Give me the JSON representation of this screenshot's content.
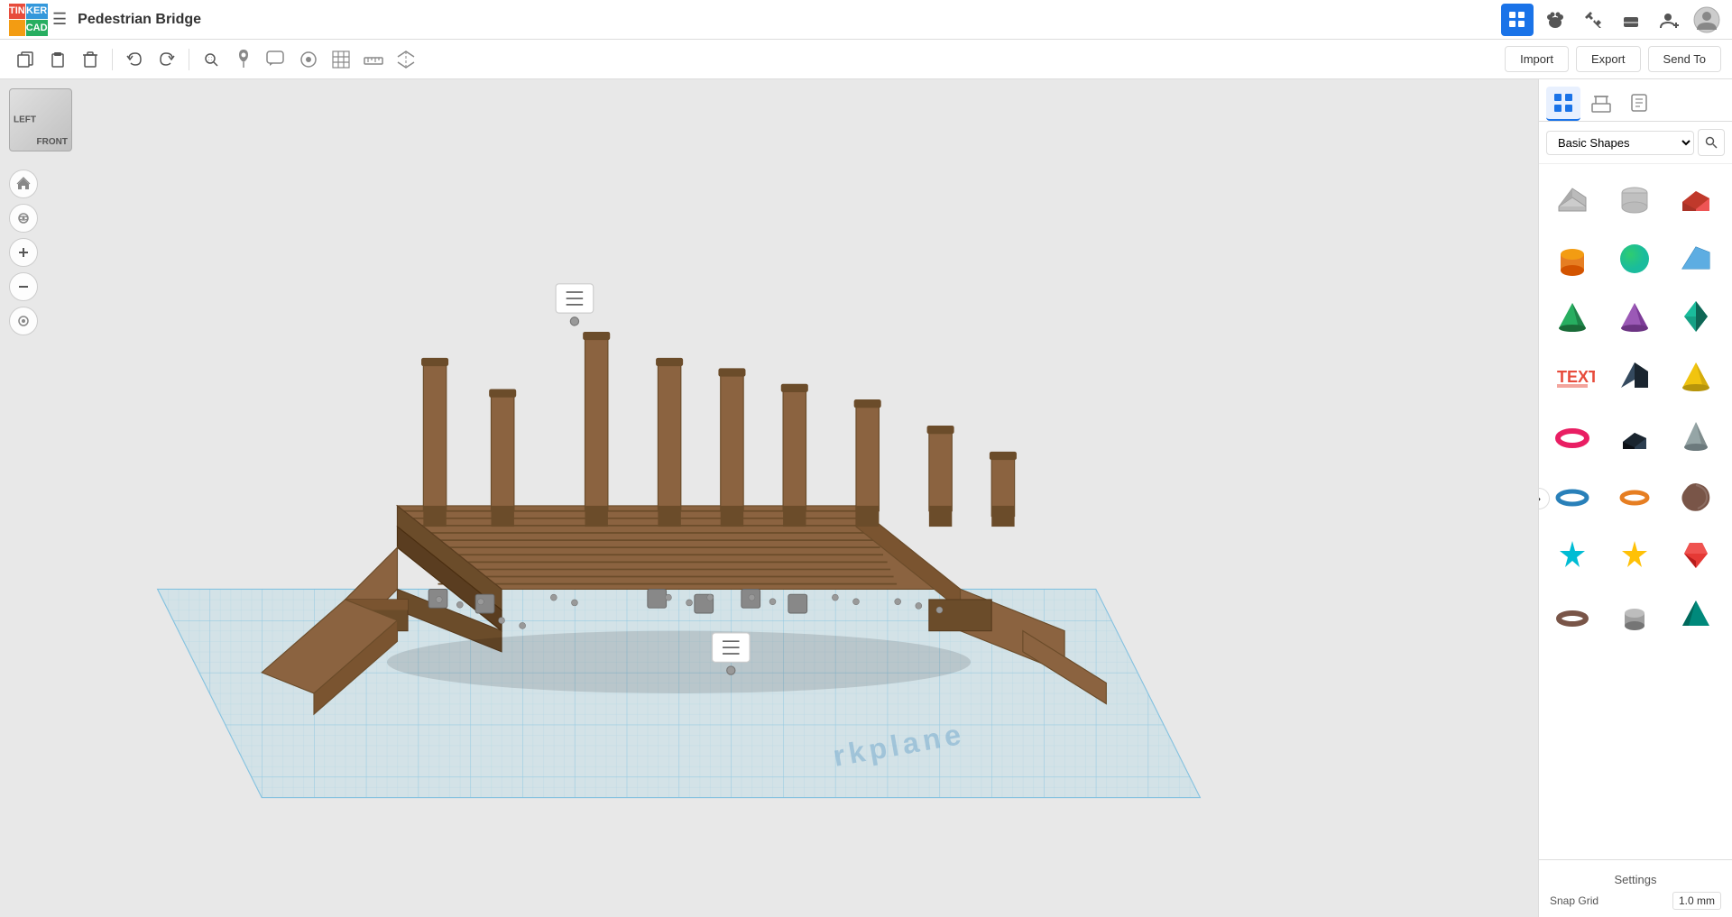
{
  "app": {
    "logo": {
      "cells": [
        "TIN",
        "KER",
        "CAD",
        ""
      ]
    },
    "project_title": "Pedestrian Bridge"
  },
  "toolbar": {
    "copy_label": "⧉",
    "paste_label": "📋",
    "delete_label": "🗑",
    "undo_label": "↩",
    "redo_label": "↪",
    "icons": {
      "search": "🔍",
      "pin": "📍",
      "bubble": "💬",
      "circle": "⭕",
      "grid": "⊞",
      "ruler": "📐",
      "flip": "⇄",
      "apps": "⊞",
      "paw": "🐾",
      "tools": "🔧",
      "briefcase": "💼",
      "profile": "👤"
    }
  },
  "view_toolbar": {
    "import_label": "Import",
    "export_label": "Export",
    "send_to_label": "Send To",
    "view_icons": [
      "🔍",
      "📍",
      "💬",
      "⭕",
      "⊞",
      "📐",
      "⇄"
    ]
  },
  "viewport": {
    "cube_labels": {
      "left": "LEFT",
      "front": "FRONT"
    },
    "workplane_text": "rkplane"
  },
  "right_panel": {
    "tabs": [
      {
        "id": "grid",
        "icon": "⊞",
        "active": true
      },
      {
        "id": "shape",
        "icon": "📐",
        "active": false
      },
      {
        "id": "notes",
        "icon": "📝",
        "active": false
      }
    ],
    "category_label": "Basic Shapes",
    "search_icon": "🔍",
    "shapes": [
      {
        "name": "Box hole",
        "color": "#aaa",
        "shape": "box-hole"
      },
      {
        "name": "Cylinder hole",
        "color": "#bbb",
        "shape": "cylinder-hole"
      },
      {
        "name": "Box solid",
        "color": "#e74c3c",
        "shape": "box-solid"
      },
      {
        "name": "Cylinder",
        "color": "#e67e22",
        "shape": "cylinder"
      },
      {
        "name": "Sphere",
        "color": "#1abc9c",
        "shape": "sphere"
      },
      {
        "name": "Shape3",
        "color": "#3498db",
        "shape": "wedge"
      },
      {
        "name": "Pyramid green",
        "color": "#27ae60",
        "shape": "pyramid-green"
      },
      {
        "name": "Pyramid purple",
        "color": "#9b59b6",
        "shape": "pyramid-purple"
      },
      {
        "name": "Diamond teal",
        "color": "#16a085",
        "shape": "diamond"
      },
      {
        "name": "Text",
        "color": "#e74c3c",
        "shape": "text"
      },
      {
        "name": "Prism blue",
        "color": "#2c3e50",
        "shape": "prism"
      },
      {
        "name": "Pyramid yellow",
        "color": "#f1c40f",
        "shape": "pyramid-yellow"
      },
      {
        "name": "Torus pink",
        "color": "#e91e63",
        "shape": "torus-pink"
      },
      {
        "name": "Box dark",
        "color": "#2c3e50",
        "shape": "box-dark"
      },
      {
        "name": "Cone gray",
        "color": "#95a5a6",
        "shape": "cone"
      },
      {
        "name": "Torus blue",
        "color": "#2980b9",
        "shape": "torus-blue"
      },
      {
        "name": "Torus orange",
        "color": "#e67e22",
        "shape": "torus-orange"
      },
      {
        "name": "Shape brown",
        "color": "#795548",
        "shape": "blob"
      },
      {
        "name": "Star teal",
        "color": "#00bcd4",
        "shape": "star-teal"
      },
      {
        "name": "Star yellow",
        "color": "#ffc107",
        "shape": "star-yellow"
      },
      {
        "name": "Gem red",
        "color": "#e53935",
        "shape": "gem"
      },
      {
        "name": "Torus brown",
        "color": "#795548",
        "shape": "torus-brown"
      },
      {
        "name": "Cylinder gray",
        "color": "#9e9e9e",
        "shape": "cyl-gray"
      },
      {
        "name": "Shape teal2",
        "color": "#00897b",
        "shape": "shape-teal2"
      }
    ],
    "settings_label": "Settings",
    "snap_grid_label": "Snap Grid",
    "snap_value": "1.0 mm"
  }
}
